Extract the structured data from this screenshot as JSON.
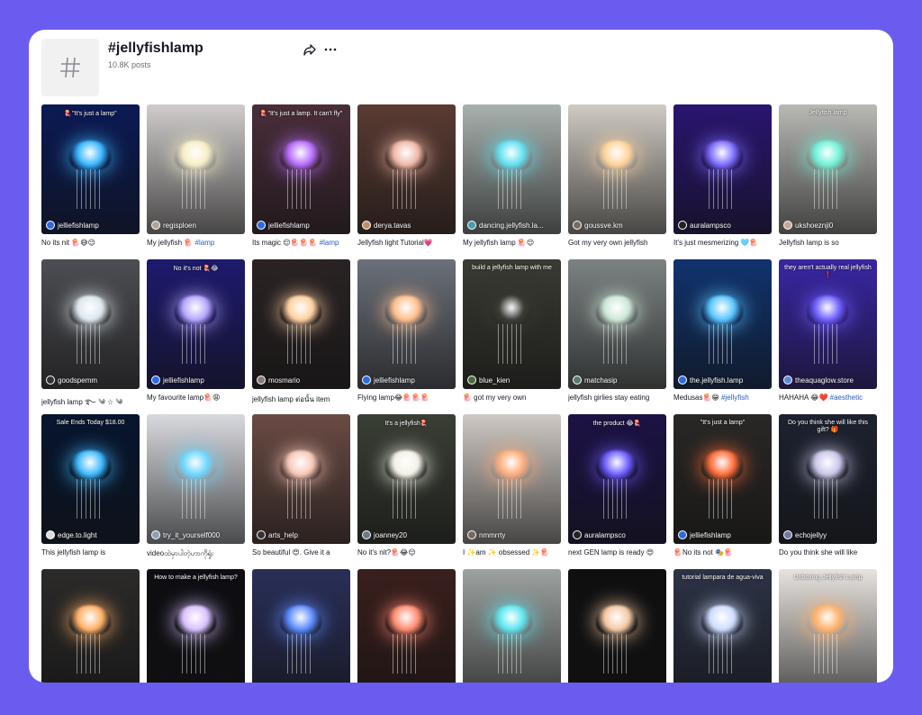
{
  "page": {
    "title": "#jellyfishlamp",
    "posts": "10.8K posts"
  },
  "icons": {
    "hash": "hashtag-icon",
    "share": "share-icon",
    "more": "more-icon"
  },
  "colors": {
    "background": "#6b5cf0",
    "card": "#ffffff",
    "hashtag_link": "#2b5db9"
  },
  "tiles": [
    {
      "user": "jelliefishlamp",
      "caption": "No its nit 🪼😅😌",
      "tag": "",
      "overlay": "🪼\"It's just a lamp\"",
      "bg": "#0b1a55",
      "glow": "#37b6ff",
      "ava": "#2b6de0"
    },
    {
      "user": "regisploen",
      "caption": "My jellyfish 🪼 ",
      "tag": "#lamp",
      "overlay": "",
      "bg": "#cfcccb",
      "glow": "#f6efc5",
      "ava": "#b0a39a"
    },
    {
      "user": "jelliefishlamp",
      "caption": "Its magic 😌🪼🪼🪼 ",
      "tag": "#lamp",
      "overlay": "🪼\"It's just a lamp. It can't fly\"",
      "bg": "#4a2e3a",
      "glow": "#b66bff",
      "ava": "#2b6de0"
    },
    {
      "user": "derya.tavas",
      "caption": "Jellyfish light Tutorial💗",
      "tag": "",
      "overlay": "",
      "bg": "#5a3b33",
      "glow": "#f0b8a8",
      "ava": "#c58c6a"
    },
    {
      "user": "dancing.jellyfish.la...",
      "caption": "My jellyfish lamp 🪼😌",
      "tag": "",
      "overlay": "",
      "bg": "#a9b1ae",
      "glow": "#5fe0f0",
      "ava": "#4a9cae"
    },
    {
      "user": "goussve.km",
      "caption": "Got my very own jellyfish",
      "tag": "",
      "overlay": "",
      "bg": "#cfcac3",
      "glow": "#ffd39a",
      "ava": "#7a6c60"
    },
    {
      "user": "auralampsco",
      "caption": "It's just mesmerizing 🩵🪼",
      "tag": "",
      "overlay": "",
      "bg": "#2a1570",
      "glow": "#7c6cff",
      "ava": "#222"
    },
    {
      "user": "ukshoeznji0",
      "caption": "Jellyfish lamp is so",
      "tag": "",
      "overlay": "Jellyfish lamp",
      "bg": "#b9b9b5",
      "glow": "#6ff2d8",
      "ava": "#c6a79a"
    },
    {
      "user": "goodspemm",
      "caption": "jellyfish lamp ࿐ ༄ ☆ ༄",
      "tag": "",
      "overlay": "",
      "bg": "#4d4e53",
      "glow": "#dde7ee",
      "ava": "#333"
    },
    {
      "user": "jelliefishlamp",
      "caption": "My favourite lamp🪼😩",
      "tag": "",
      "overlay": "No it's not 🪼😂",
      "bg": "#1d1a6e",
      "glow": "#b6a6ff",
      "ava": "#2b6de0"
    },
    {
      "user": "mosmario",
      "caption": "jellyfish lamp ต่อนั้น item",
      "tag": "",
      "overlay": "",
      "bg": "#2a2324",
      "glow": "#ffd0a0",
      "ava": "#8a7a7a"
    },
    {
      "user": "jelliefishlamp",
      "caption": "Flying lamp😂🪼🪼🪼",
      "tag": "",
      "overlay": "",
      "bg": "#6b707a",
      "glow": "#ffbe8c",
      "ava": "#2b6de0"
    },
    {
      "user": "blue_kien",
      "caption": "🪼 got my very own",
      "tag": "",
      "overlay": "build a jellyfish lamp with me",
      "bg": "#3a3b33",
      "glow": "#3a3b33",
      "ava": "#4a6b3a"
    },
    {
      "user": "matchasip",
      "caption": "jellyfish girlies stay eating",
      "tag": "",
      "overlay": "",
      "bg": "#7c8282",
      "glow": "#cde8d8",
      "ava": "#5a7a6a"
    },
    {
      "user": "the.jellyfish.lamp",
      "caption": "Medusas🪼😁 ",
      "tag": "#jellyfish",
      "overlay": "",
      "bg": "#11336e",
      "glow": "#58c6ff",
      "ava": "#2b6de0"
    },
    {
      "user": "theaquaglow.store",
      "caption": "HAHAHA 😂❤️ ",
      "tag": "#aesthetic",
      "overlay": "they aren't actually real jellyfish ❗",
      "bg": "#3926a4",
      "glow": "#6f60ff",
      "ava": "#5c88d8"
    },
    {
      "user": "edge.to.light",
      "caption": "This jellyfish lamp is",
      "tag": "",
      "overlay": "Sale Ends Today $18.00",
      "bg": "#07152e",
      "glow": "#3cb8ff",
      "ava": "#ddd"
    },
    {
      "user": "try_it_yourself000",
      "caption": "videoထဲမှာပါတဲ့ဟာကိုရှုံး",
      "tag": "",
      "overlay": "",
      "bg": "#d9dadf",
      "glow": "#6ad6ff",
      "ava": "#8aa0b6"
    },
    {
      "user": "arts_help",
      "caption": "So beautiful 😍. Give it a",
      "tag": "",
      "overlay": "",
      "bg": "#6a4b44",
      "glow": "#f7c8b8",
      "ava": "#333"
    },
    {
      "user": "joanney20",
      "caption": "No it's nit?🪼😂😌",
      "tag": "",
      "overlay": "It's a jellyfish🪼",
      "bg": "#3a3f35",
      "glow": "#f3f0e6",
      "ava": "#6a7a8a"
    },
    {
      "user": "nmmrrty",
      "caption": "I ✨am ✨ obsessed ✨🪼",
      "tag": "",
      "overlay": "",
      "bg": "#cfc9c4",
      "glow": "#ffab7a",
      "ava": "#7a6a5a"
    },
    {
      "user": "auralampsco",
      "caption": "next GEN lamp is ready 😍",
      "tag": "",
      "overlay": "the product 😂🪼",
      "bg": "#1c1245",
      "glow": "#6c5cff",
      "ava": "#222"
    },
    {
      "user": "jelliefishlamp",
      "caption": "🪼No its not 🎭🪼",
      "tag": "",
      "overlay": "\"It's just a lamp\"",
      "bg": "#2a2826",
      "glow": "#ff6a36",
      "ava": "#2b6de0"
    },
    {
      "user": "echojellyy",
      "caption": "Do you think she will like",
      "tag": "",
      "overlay": "Do you think she will like this gift? 🎁",
      "bg": "#1d2230",
      "glow": "#c9c5e8",
      "ava": "#6b7aa0"
    },
    {
      "user": "",
      "caption": "",
      "tag": "",
      "overlay": "",
      "bg": "#2c2a29",
      "glow": "#ffb066",
      "ava": ""
    },
    {
      "user": "",
      "caption": "",
      "tag": "",
      "overlay": "How to make a jellyfish lamp?",
      "bg": "#0d0d12",
      "glow": "#d8c0ff",
      "ava": ""
    },
    {
      "user": "",
      "caption": "",
      "tag": "",
      "overlay": "",
      "bg": "#2a2f58",
      "glow": "#5c8bff",
      "ava": ""
    },
    {
      "user": "",
      "caption": "",
      "tag": "",
      "overlay": "",
      "bg": "#3a1f1d",
      "glow": "#ff8a70",
      "ava": ""
    },
    {
      "user": "",
      "caption": "",
      "tag": "",
      "overlay": "",
      "bg": "#9da2a0",
      "glow": "#5ae6f0",
      "ava": ""
    },
    {
      "user": "",
      "caption": "",
      "tag": "",
      "overlay": "",
      "bg": "#0f0f10",
      "glow": "#f4c8a4",
      "ava": ""
    },
    {
      "user": "",
      "caption": "",
      "tag": "",
      "overlay": "tutorial lampara de agua-viva",
      "bg": "#2c3346",
      "glow": "#cfdcff",
      "ava": ""
    },
    {
      "user": "",
      "caption": "",
      "tag": "",
      "overlay": "Unboxing Jellyfish Lamp",
      "bg": "#e7e3df",
      "glow": "#ffb16a",
      "ava": ""
    }
  ]
}
